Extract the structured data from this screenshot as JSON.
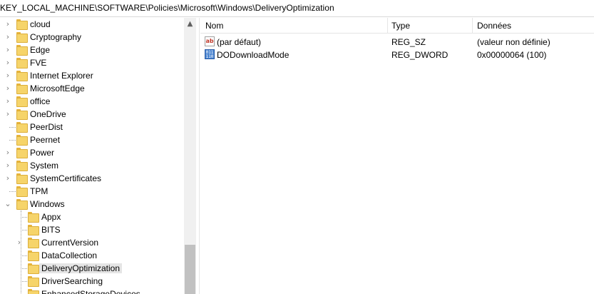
{
  "address": "KEY_LOCAL_MACHINE\\SOFTWARE\\Policies\\Microsoft\\Windows\\DeliveryOptimization",
  "tree": {
    "items": [
      {
        "label": "cloud",
        "expander": "›"
      },
      {
        "label": "Cryptography",
        "expander": "›"
      },
      {
        "label": "Edge",
        "expander": "›"
      },
      {
        "label": "FVE",
        "expander": "›"
      },
      {
        "label": "Internet Explorer",
        "expander": "›"
      },
      {
        "label": "MicrosoftEdge",
        "expander": "›"
      },
      {
        "label": "office",
        "expander": "›"
      },
      {
        "label": "OneDrive",
        "expander": "›"
      },
      {
        "label": "PeerDist",
        "expander": ""
      },
      {
        "label": "Peernet",
        "expander": ""
      },
      {
        "label": "Power",
        "expander": "›"
      },
      {
        "label": "System",
        "expander": "›"
      },
      {
        "label": "SystemCertificates",
        "expander": "›"
      },
      {
        "label": "TPM",
        "expander": ""
      },
      {
        "label": "Windows",
        "expander": "⌄"
      },
      {
        "label": "Appx",
        "expander": ""
      },
      {
        "label": "BITS",
        "expander": ""
      },
      {
        "label": "CurrentVersion",
        "expander": "›"
      },
      {
        "label": "DataCollection",
        "expander": ""
      },
      {
        "label": "DeliveryOptimization",
        "expander": ""
      },
      {
        "label": "DriverSearching",
        "expander": ""
      },
      {
        "label": "EnhancedStorageDevices",
        "expander": ""
      }
    ],
    "selected": "DeliveryOptimization"
  },
  "scrollbar": {
    "up_arrow": "▲"
  },
  "list": {
    "columns": [
      "Nom",
      "Type",
      "Données"
    ],
    "rows": [
      {
        "icon": "string-value-icon",
        "icon_text": "ab",
        "name": "(par défaut)",
        "type": "REG_SZ",
        "data": "(valeur non définie)"
      },
      {
        "icon": "dword-value-icon",
        "icon_text": "011 110",
        "name": "DODownloadMode",
        "type": "REG_DWORD",
        "data": "0x00000064 (100)"
      }
    ]
  }
}
